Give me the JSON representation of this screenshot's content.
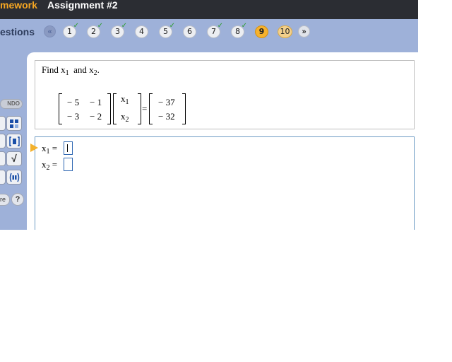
{
  "header": {
    "homework_label": "mework",
    "assignment_title": "Assignment #2"
  },
  "questions_bar": {
    "label": "estions",
    "prev_arrow": "«",
    "next_arrow": "»",
    "items": [
      {
        "label": "1",
        "answered": true
      },
      {
        "label": "2",
        "answered": true
      },
      {
        "label": "3",
        "answered": true
      },
      {
        "label": "4",
        "answered": false
      },
      {
        "label": "5",
        "answered": true
      },
      {
        "label": "6",
        "answered": false
      },
      {
        "label": "7",
        "answered": true
      },
      {
        "label": "8",
        "answered": true
      },
      {
        "label": "9",
        "answered": false,
        "current": true
      },
      {
        "label": "10",
        "answered": false
      }
    ],
    "check_mark": "✓"
  },
  "tools": {
    "undo_label": "NDO",
    "more_label": "re",
    "help_label": "?",
    "sqrt_label": "√",
    "icons": [
      "matrix-template-icon",
      "bracket-template-icon",
      "sqrt-icon",
      "parentheses-template-icon"
    ]
  },
  "question": {
    "find_text": "Find",
    "and_text": "and",
    "var_x": "x",
    "sub1": "1",
    "sub2": "2",
    "period": ".",
    "matrix_a": [
      [
        "− 5",
        "− 1"
      ],
      [
        "− 3",
        "− 2"
      ]
    ],
    "vector_x": [
      "x",
      "x"
    ],
    "vector_b": [
      "− 37",
      "− 32"
    ],
    "equals": "="
  },
  "answer": {
    "rows": [
      {
        "var": "x",
        "sub": "1",
        "equals": "=",
        "value": ""
      },
      {
        "var": "x",
        "sub": "2",
        "equals": "=",
        "value": ""
      }
    ]
  },
  "colors": {
    "accent": "#f6b22e",
    "nav_bg": "#9eb1d9",
    "titlebar_bg": "#2b2d33",
    "input_border": "#2f67b2"
  }
}
